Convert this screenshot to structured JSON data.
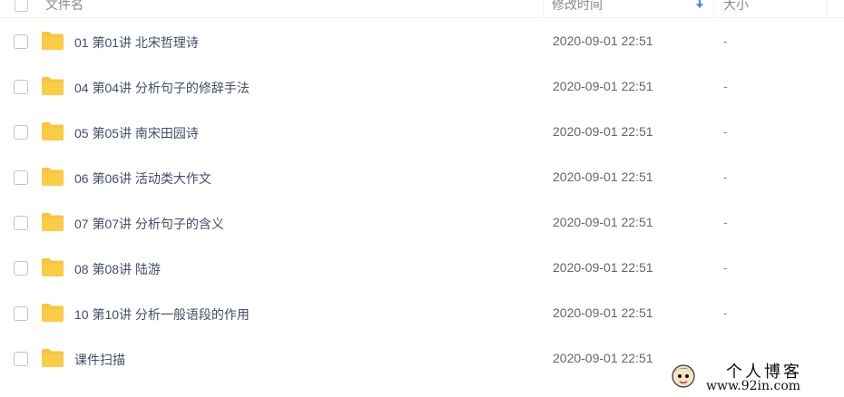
{
  "header": {
    "name_label": "文件名",
    "time_label": "修改时间",
    "size_label": "大小",
    "sort_icon": "arrow-down-icon"
  },
  "files": [
    {
      "name": "01 第01讲 北宋哲理诗",
      "time": "2020-09-01 22:51",
      "size": "-"
    },
    {
      "name": "04 第04讲 分析句子的修辞手法",
      "time": "2020-09-01 22:51",
      "size": "-"
    },
    {
      "name": "05 第05讲 南宋田园诗",
      "time": "2020-09-01 22:51",
      "size": "-"
    },
    {
      "name": "06 第06讲 活动类大作文",
      "time": "2020-09-01 22:51",
      "size": "-"
    },
    {
      "name": "07 第07讲 分析句子的含义",
      "time": "2020-09-01 22:51",
      "size": "-"
    },
    {
      "name": "08 第08讲 陆游",
      "time": "2020-09-01 22:51",
      "size": "-"
    },
    {
      "name": "10 第10讲 分析一般语段的作用",
      "time": "2020-09-01 22:51",
      "size": "-"
    },
    {
      "name": "课件扫描",
      "time": "2020-09-01 22:51",
      "size": ""
    }
  ],
  "icons": {
    "folder": "folder-icon",
    "checkbox": "checkbox-icon"
  },
  "colors": {
    "folder": "#f8c63c",
    "sort_arrow": "#3b8cff",
    "filename": "#424e67"
  },
  "watermark": {
    "title": "个人博客",
    "url": "www.92in.com"
  }
}
